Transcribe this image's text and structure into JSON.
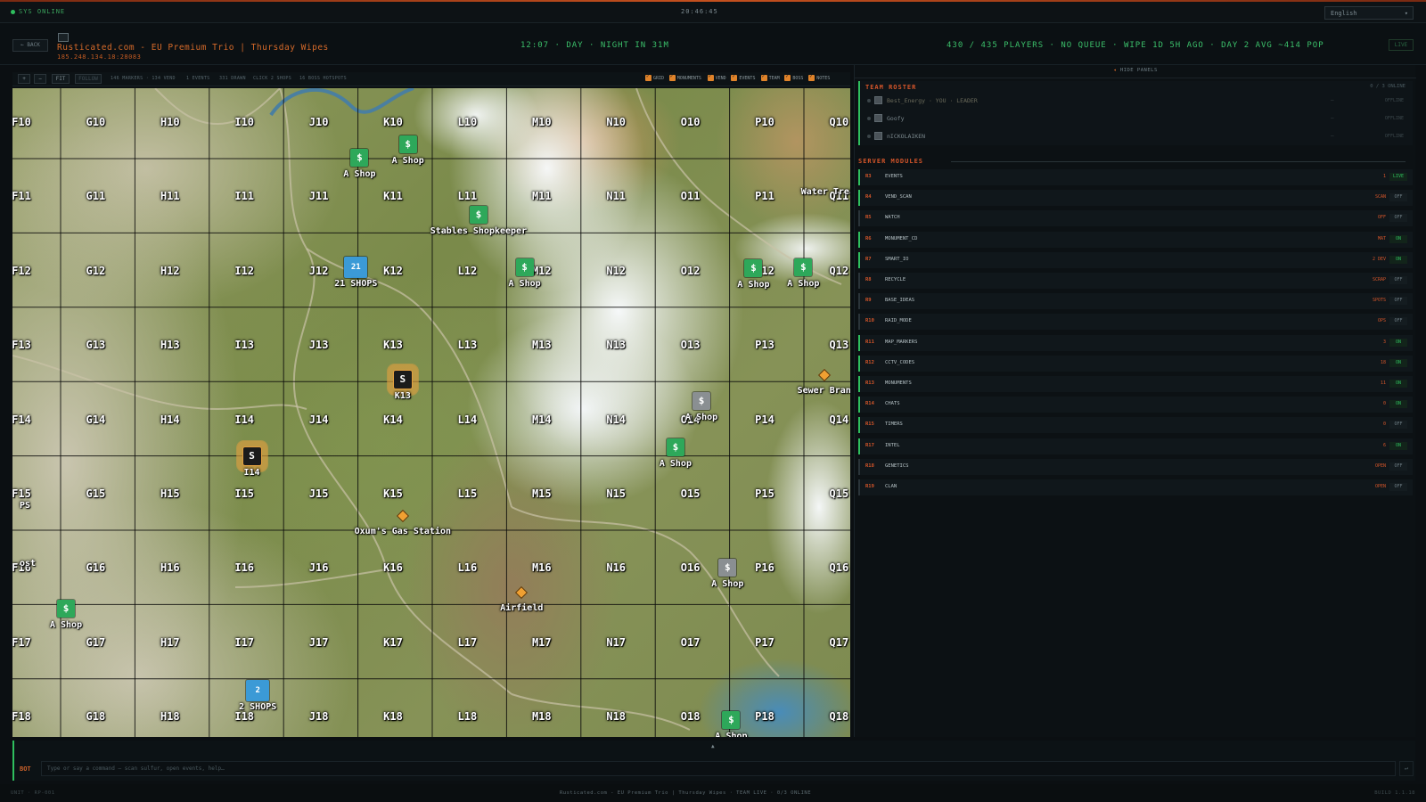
{
  "topbar": {
    "sys_status": "SYS ONLINE",
    "clock": "20:46:45",
    "language": "English"
  },
  "header": {
    "back_label": "← BACK",
    "server_name": "Rusticated.com - EU Premium Trio | Thursday Wipes",
    "server_ip": "185.248.134.18:28083",
    "time_info": "12:07 · DAY · NIGHT IN 31M",
    "population": "430 / 435 PLAYERS · NO QUEUE · WIPE 1D 5H AGO · DAY 2 AVG ~414 POP",
    "live_label": "LIVE"
  },
  "toolbar": {
    "zoom_in": "+",
    "zoom_out": "−",
    "fit": "FIT",
    "follow": "FOLLOW",
    "markers_info": "146 MARKERS · 134 VEND",
    "events_info": "1 EVENTS",
    "drawn_info": "331 DRAWN",
    "shops_info": "CLICK 2 SHOPS",
    "hotspots_info": "16 BOSS HOTSPOTS",
    "filters": [
      "GRID",
      "MONUMENTS",
      "VEND",
      "EVENTS",
      "TEAM",
      "BOSS",
      "NOTES"
    ]
  },
  "map": {
    "grid_cols": [
      "F",
      "G",
      "H",
      "I",
      "J",
      "K",
      "L",
      "M",
      "N",
      "O",
      "P",
      "Q"
    ],
    "grid_rows": [
      "10",
      "11",
      "12",
      "13",
      "14",
      "15",
      "16",
      "17",
      "18"
    ],
    "markers": [
      {
        "kind": "green",
        "glyph": "$",
        "col": 4.55,
        "row": 0.48,
        "label": "A Shop"
      },
      {
        "kind": "green",
        "glyph": "$",
        "col": 5.2,
        "row": 0.3,
        "label": "A Shop"
      },
      {
        "kind": "green",
        "glyph": "$",
        "col": 6.15,
        "row": 1.25,
        "label": "Stables Shopkeeper"
      },
      {
        "kind": "blue",
        "glyph": "21",
        "col": 4.5,
        "row": 1.95,
        "label": "21 SHOPS"
      },
      {
        "kind": "green",
        "glyph": "$",
        "col": 6.77,
        "row": 1.95,
        "label": "A Shop"
      },
      {
        "kind": "green",
        "glyph": "$",
        "col": 9.85,
        "row": 1.97,
        "label": "A Shop"
      },
      {
        "kind": "green",
        "glyph": "$",
        "col": 10.52,
        "row": 1.95,
        "label": "A Shop"
      },
      {
        "kind": "dark",
        "glyph": "S",
        "col": 5.13,
        "row": 3.47,
        "label": "K13"
      },
      {
        "kind": "gray",
        "glyph": "$",
        "col": 9.15,
        "row": 3.75,
        "label": "A Shop"
      },
      {
        "kind": "green",
        "glyph": "$",
        "col": 8.8,
        "row": 4.38,
        "label": "A Shop"
      },
      {
        "kind": "dark",
        "glyph": "S",
        "col": 3.1,
        "row": 4.5,
        "label": "I14"
      },
      {
        "kind": "gray",
        "glyph": "$",
        "col": 9.5,
        "row": 6.0,
        "label": "A Shop"
      },
      {
        "kind": "green",
        "glyph": "$",
        "col": 0.6,
        "row": 6.55,
        "label": "A Shop"
      },
      {
        "kind": "blue",
        "glyph": "2",
        "col": 3.18,
        "row": 7.65,
        "label": "2 SHOPS"
      },
      {
        "kind": "green",
        "glyph": "$",
        "col": 9.55,
        "row": 8.05,
        "label": "A Shop"
      }
    ],
    "places": [
      {
        "col": 10.85,
        "row": 0.88,
        "label": "Water Trea"
      },
      {
        "col": 10.8,
        "row": 3.55,
        "label": "Sewer Bran",
        "diamond": true
      },
      {
        "col": 5.13,
        "row": 5.44,
        "label": "Oxum's Gas Station",
        "diamond": true
      },
      {
        "col": 6.73,
        "row": 6.48,
        "label": "Airfield",
        "diamond": true
      }
    ],
    "edge_labels": [
      {
        "col": 0.02,
        "row": 5.1,
        "label": "PS"
      },
      {
        "col": 0.02,
        "row": 5.87,
        "label": "ost"
      }
    ]
  },
  "right_panel": {
    "hide_label": "HIDE PANELS",
    "roster_title": "TEAM ROSTER",
    "roster_count": "0 / 3 ONLINE",
    "roster": [
      {
        "name": "Best_Energy · YOU · LEADER",
        "dash": "—",
        "status": "OFFLINE"
      },
      {
        "name": "Goofy",
        "dash": "—",
        "status": "OFFLINE"
      },
      {
        "name": "nICKOLAIKEN",
        "dash": "—",
        "status": "OFFLINE"
      }
    ],
    "modules_title": "SERVER MODULES",
    "modules": [
      {
        "id": "R3",
        "name": "EVENTS",
        "meta": "1",
        "toggle": "LIVE",
        "on": true
      },
      {
        "id": "R4",
        "name": "VEND_SCAN",
        "meta": "SCAN",
        "toggle": "OFF",
        "on": true
      },
      {
        "id": "R5",
        "name": "WATCH",
        "meta": "OFF",
        "toggle": "OFF",
        "on": false
      },
      {
        "id": "R6",
        "name": "MONUMENT_CD",
        "meta": "MAT",
        "toggle": "ON",
        "on": true
      },
      {
        "id": "R7",
        "name": "SMART_IO",
        "meta": "2 DEV",
        "toggle": "ON",
        "on": true
      },
      {
        "id": "R8",
        "name": "RECYCLE",
        "meta": "SCRAP",
        "toggle": "OFF",
        "on": false
      },
      {
        "id": "R9",
        "name": "BASE_IDEAS",
        "meta": "SPOTS",
        "toggle": "OFF",
        "on": false
      },
      {
        "id": "R10",
        "name": "RAID_MODE",
        "meta": "OPS",
        "toggle": "OFF",
        "on": false
      },
      {
        "id": "R11",
        "name": "MAP_MARKERS",
        "meta": "3",
        "toggle": "ON",
        "on": true
      },
      {
        "id": "R12",
        "name": "CCTV_CODES",
        "meta": "18",
        "toggle": "ON",
        "on": true
      },
      {
        "id": "R13",
        "name": "MONUMENTS",
        "meta": "11",
        "toggle": "ON",
        "on": true
      },
      {
        "id": "R14",
        "name": "CHATS",
        "meta": "0",
        "toggle": "ON",
        "on": true
      },
      {
        "id": "R15",
        "name": "TIMERS",
        "meta": "0",
        "toggle": "OFF",
        "on": true
      },
      {
        "id": "R17",
        "name": "INTEL",
        "meta": "6",
        "toggle": "ON",
        "on": true
      },
      {
        "id": "R18",
        "name": "GENETICS",
        "meta": "OPEN",
        "toggle": "OFF",
        "on": false
      },
      {
        "id": "R19",
        "name": "CLAN",
        "meta": "OPEN",
        "toggle": "OFF",
        "on": false
      }
    ]
  },
  "command": {
    "prefix": "BOT",
    "placeholder": "Type or say a command — scan sulfur, open events, help…",
    "send": "↵",
    "collapse": "▲"
  },
  "footer": {
    "left": "UNIT · RP-001",
    "center": "Rusticated.com - EU Premium Trio | Thursday Wipes · TEAM LIVE · 0/3 ONLINE",
    "right": "BUILD 1.1.18"
  }
}
